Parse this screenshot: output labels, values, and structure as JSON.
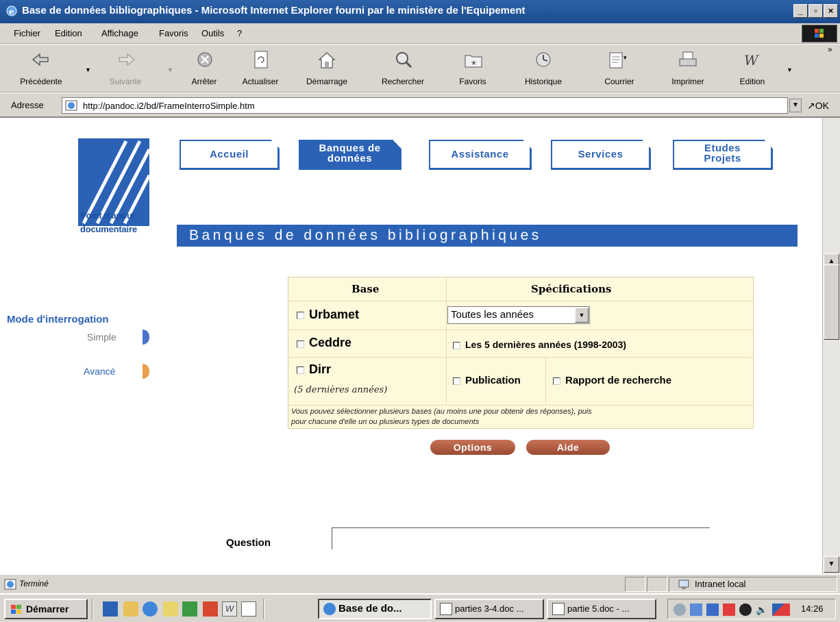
{
  "window": {
    "title": "Base de données bibliographiques - Microsoft Internet Explorer fourni par le ministère de l'Equipement"
  },
  "menu": [
    {
      "label": "Fichier"
    },
    {
      "label": "Edition"
    },
    {
      "label": "Affichage"
    },
    {
      "label": "Favoris"
    },
    {
      "label": "Outils"
    },
    {
      "label": "?"
    }
  ],
  "toolbar": {
    "back": "Précédente",
    "forward": "Suivante",
    "stop": "Arrêter",
    "refresh": "Actualiser",
    "home": "Démarrage",
    "search": "Rechercher",
    "favorites": "Favoris",
    "history": "Historique",
    "mail": "Courrier",
    "print": "Imprimer",
    "edit": "Edition",
    "more": "»"
  },
  "address": {
    "label": "Adresse",
    "url": "http://pandoc.i2/bd/FrameInterroSimple.htm",
    "go": "OK"
  },
  "site": {
    "logo_line1": "Point d'appui",
    "logo_line2": "documentaire",
    "tabs": {
      "accueil": "Accueil",
      "banques_1": "Banques de",
      "banques_2": "données",
      "assistance": "Assistance",
      "services": "Services",
      "etudes_1": "Etudes",
      "etudes_2": "Projets"
    },
    "banner": "Banques de données bibliographiques"
  },
  "left_nav": {
    "title": "Mode d'interrogation",
    "simple": "Simple",
    "avance": "Avancé"
  },
  "search_table": {
    "col_base": "Base",
    "col_specs": "Spécifications",
    "urbamet": "Urbamet",
    "year_select": "Toutes les années",
    "ceddre": "Ceddre",
    "ceddre_spec": "Les 5 dernières années (1998-2003)",
    "dirr": "Dirr",
    "dirr_note": "(5 dernières années)",
    "publication": "Publication",
    "rapport": "Rapport de recherche",
    "help_line1": "Vous pouvez sélectionner plusieurs bases (au moins une pour obtenir des réponses), puis",
    "help_line2": "pour chacune d'elle un ou plusieurs types de documents"
  },
  "buttons": {
    "options": "Options",
    "aide": "Aide"
  },
  "question": {
    "label": "Question",
    "value": ""
  },
  "status": {
    "text": "Terminé",
    "zone": "Intranet local"
  },
  "taskbar": {
    "start": "Démarrer",
    "tasks": [
      {
        "label": "Base de do..."
      },
      {
        "label": "parties 3-4.doc ..."
      },
      {
        "label": "partie 5.doc - ..."
      }
    ],
    "clock": "14:26"
  },
  "colors": {
    "accent_blue": "#2b62b5",
    "table_bg": "#fff9dc",
    "button_brown": "#a9553b"
  }
}
